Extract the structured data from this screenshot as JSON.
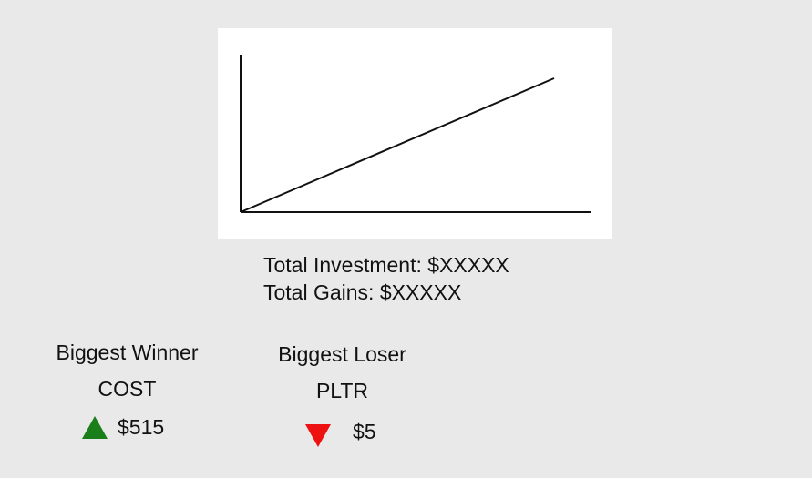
{
  "totals": {
    "investment": "Total Investment: $XXXXX",
    "gains": "Total Gains: $XXXXX"
  },
  "winner": {
    "title": "Biggest Winner",
    "ticker": "COST",
    "amount": "$515",
    "direction": "up",
    "color": "#1a7f1a"
  },
  "loser": {
    "title": "Biggest Loser",
    "ticker": "PLTR",
    "amount": "$5",
    "direction": "down",
    "color": "#ee1111"
  },
  "colors": {
    "background": "#e9e9e9",
    "card": "#ffffff",
    "line": "#111111"
  }
}
